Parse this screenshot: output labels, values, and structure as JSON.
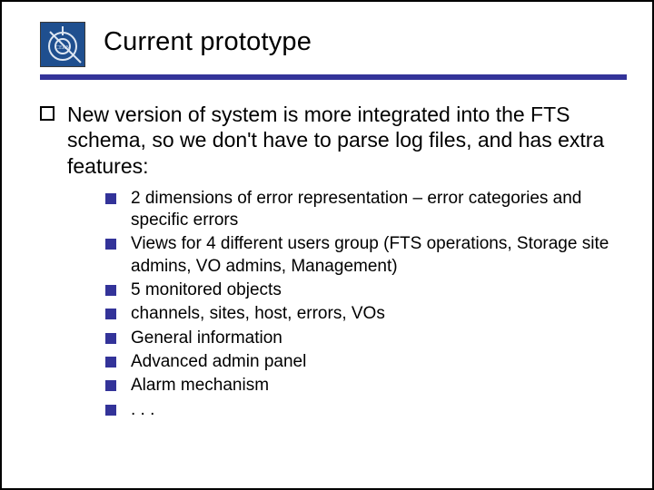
{
  "title": "Current prototype",
  "main_point": "New version of system is more integrated into the FTS schema, so we don't have to parse log files, and has extra features:",
  "features": [
    "2 dimensions of error representation – error categories and specific errors",
    "Views for 4 different users group (FTS operations, Storage site admins, VO admins, Management)",
    "5 monitored objects",
    "channels, sites, host, errors, VOs",
    "General information",
    "Advanced admin panel",
    "Alarm mechanism",
    ". . ."
  ],
  "logo_label": "CERN"
}
